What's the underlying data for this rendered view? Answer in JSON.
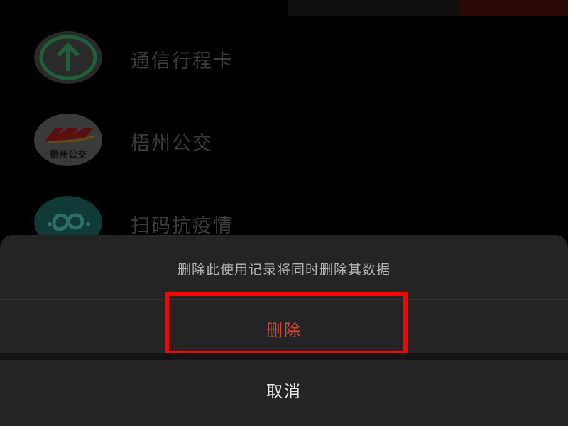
{
  "apps": [
    {
      "label": "通信行程卡",
      "icon": "arrow-up-circle-icon"
    },
    {
      "label": "梧州公交",
      "icon": "bus-logo-icon",
      "logo_text": "梧州公交"
    },
    {
      "label": "扫码抗疫情",
      "icon": "scan-qr-icon"
    }
  ],
  "dialog": {
    "message": "删除此使用记录将同时删除其数据",
    "delete_label": "删除",
    "cancel_label": "取消"
  },
  "colors": {
    "background": "#000000",
    "sheet": "#242424",
    "delete_text": "#d2473a",
    "highlight": "#ff0000",
    "cancel_text": "#e6e6e6"
  }
}
